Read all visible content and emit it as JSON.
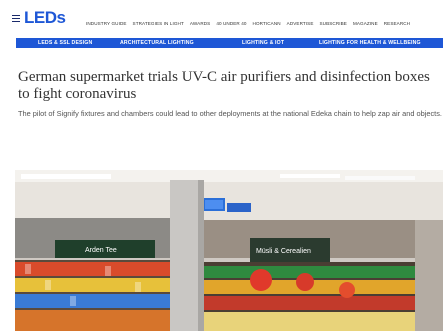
{
  "header": {
    "logo_text": "LEDs",
    "menu_icon": "hamburger-icon",
    "nav": [
      "INDUSTRY GUIDE",
      "STRATEGIES IN LIGHT",
      "AWARDS",
      "40 UNDER 40",
      "HORTICANN",
      "ADVERTISE",
      "SUBSCRIBE",
      "MAGAZINE",
      "RESEARCH"
    ]
  },
  "subnav": {
    "items": [
      "LEDS & SSL DESIGN",
      "ARCHITECTURAL LIGHTING",
      "LIGHTING & IOT",
      "LIGHTING FOR HEALTH & WELLBEING"
    ],
    "bg_color": "#1e57d6"
  },
  "article": {
    "title": "German supermarket trials UV-C air purifiers and disinfection boxes to fight coronavirus",
    "dek": "The pilot of Signify fixtures and chambers could lead to other deployments at the national Edeka chain to help zap air and objects."
  },
  "photo": {
    "sign_left": "Arden Tee",
    "sign_right": "Müsli & Cerealien"
  }
}
